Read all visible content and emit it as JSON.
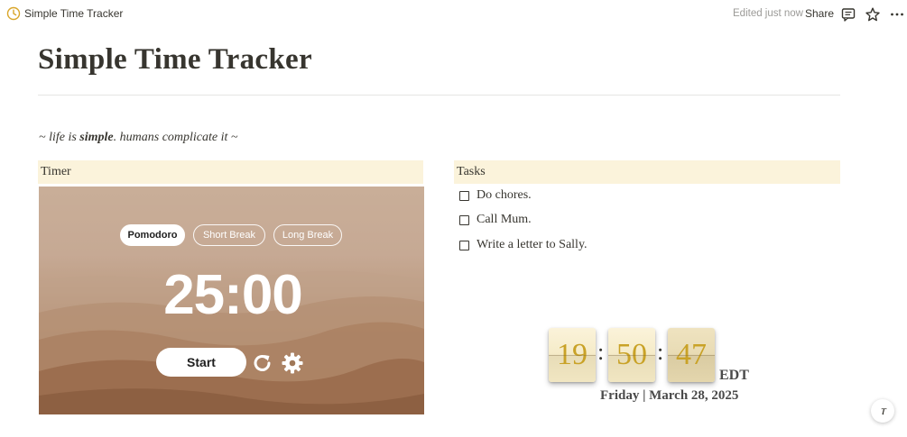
{
  "topbar": {
    "page_title": "Simple Time Tracker",
    "edited": "Edited just now",
    "share_label": "Share",
    "icons": [
      "clock-icon",
      "comment-icon",
      "star-icon",
      "more-icon"
    ]
  },
  "page": {
    "title": "Simple Time Tracker",
    "quote_prefix": "~ life is ",
    "quote_bold": "simple",
    "quote_suffix": ". humans complicate it ~"
  },
  "timer_section": {
    "header": "Timer",
    "modes": [
      "Pomodoro",
      "Short Break",
      "Long Break"
    ],
    "active_mode": "Pomodoro",
    "time": "25:00",
    "start_label": "Start",
    "icons": [
      "reset-icon",
      "settings-icon"
    ]
  },
  "tasks_section": {
    "header": "Tasks",
    "items": [
      {
        "label": "Do chores.",
        "checked": false
      },
      {
        "label": "Call Mum.",
        "checked": false
      },
      {
        "label": "Write a letter to Sally.",
        "checked": false
      }
    ]
  },
  "clock": {
    "hours": "19",
    "minutes": "50",
    "seconds": "47",
    "separator": ":",
    "timezone": "EDT",
    "date": "Friday | March 28, 2025",
    "digit_color": "#c9a227"
  },
  "help": {
    "icon": "help-icon"
  }
}
